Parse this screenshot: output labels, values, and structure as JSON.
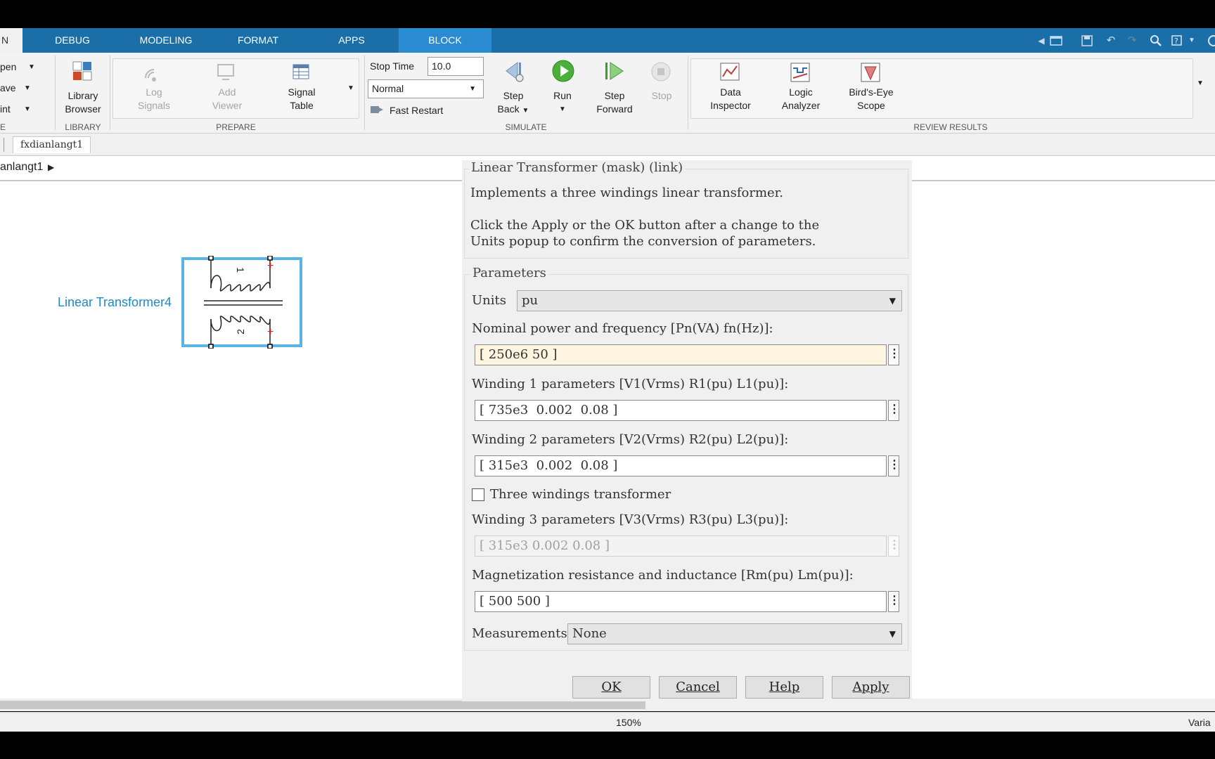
{
  "tabs": [
    {
      "label": "N"
    },
    {
      "label": "DEBUG"
    },
    {
      "label": "MODELING"
    },
    {
      "label": "FORMAT"
    },
    {
      "label": "APPS"
    },
    {
      "label": "BLOCK"
    }
  ],
  "file_group": {
    "items": [
      {
        "label": "pen"
      },
      {
        "label": "ave"
      },
      {
        "label": "int"
      }
    ],
    "label": "E"
  },
  "library": {
    "browser_line1": "Library",
    "browser_line2": "Browser",
    "group_label": "LIBRARY"
  },
  "prepare": {
    "log_line1": "Log",
    "log_line2": "Signals",
    "viewer_line1": "Add",
    "viewer_line2": "Viewer",
    "table_line1": "Signal",
    "table_line2": "Table",
    "group_label": "PREPARE"
  },
  "simulate": {
    "stop_time_label": "Stop Time",
    "stop_time_value": "10.0",
    "mode_value": "Normal",
    "fast_restart_label": "Fast Restart",
    "step_back_line1": "Step",
    "step_back_line2": "Back",
    "run_label": "Run",
    "step_forward_line1": "Step",
    "step_forward_line2": "Forward",
    "stop_label": "Stop",
    "group_label": "SIMULATE"
  },
  "review": {
    "data_line1": "Data",
    "data_line2": "Inspector",
    "logic_line1": "Logic",
    "logic_line2": "Analyzer",
    "bird_line1": "Bird's-Eye",
    "bird_line2": "Scope",
    "group_label": "REVIEW RESULTS"
  },
  "document_tab": "fxdianlangt1",
  "breadcrumb": "anlangt1",
  "block": {
    "name": "Linear Transformer4",
    "label_top": "1",
    "label_bottom": "2",
    "plus": "+"
  },
  "dialog": {
    "title": "Linear Transformer (mask) (link)",
    "description": "Implements a three windings linear transformer.",
    "note_line1": "Click the Apply or the OK button after a change to the",
    "note_line2": "Units popup to confirm the conversion of parameters.",
    "parameters_legend": "Parameters",
    "units_label": "Units",
    "units_value": "pu",
    "nominal_label": "Nominal power and frequency [Pn(VA) fn(Hz)]:",
    "nominal_value": "[ 250e6 50 ]",
    "winding1_label": "Winding 1 parameters [V1(Vrms) R1(pu) L1(pu)]:",
    "winding1_value": "[ 735e3  0.002  0.08 ]",
    "winding2_label": "Winding 2 parameters [V2(Vrms) R2(pu) L2(pu)]:",
    "winding2_value": "[ 315e3  0.002  0.08 ]",
    "three_windings_label": "Three windings transformer",
    "three_windings_checked": false,
    "winding3_label": "Winding 3 parameters [V3(Vrms) R3(pu) L3(pu)]:",
    "winding3_value": "[ 315e3 0.002 0.08 ]",
    "magnet_label": "Magnetization resistance and inductance [Rm(pu) Lm(pu)]:",
    "magnet_value": "[ 500 500 ]",
    "measurements_label": "Measurements",
    "measurements_value": "None",
    "ok": "OK",
    "cancel": "Cancel",
    "help": "Help",
    "apply": "Apply"
  },
  "status": {
    "zoom": "150%",
    "right_text": "Varia"
  },
  "colors": {
    "tab_bar": "#1a6fa8",
    "block_tab": "#2a8bd0",
    "block_selection": "#5ab4e6",
    "block_name": "#1f8ac0"
  }
}
